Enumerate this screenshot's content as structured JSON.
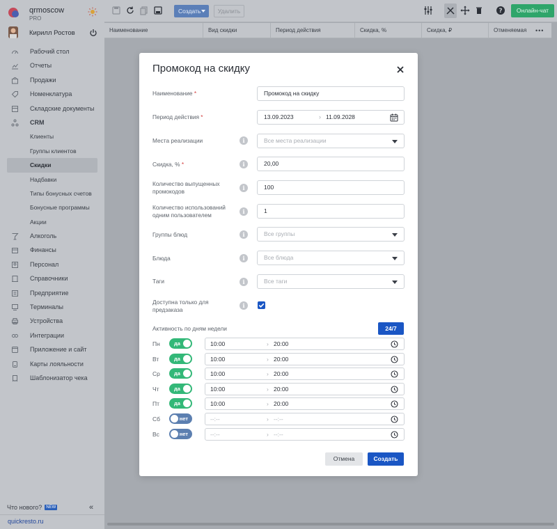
{
  "brand": {
    "name": "qrmoscow",
    "plan": "PRO"
  },
  "user": {
    "name": "Кирилл Ростов"
  },
  "sidebar": {
    "items": [
      {
        "label": "Рабочий стол",
        "icon": "dashboard-icon"
      },
      {
        "label": "Отчеты",
        "icon": "reports-icon"
      },
      {
        "label": "Продажи",
        "icon": "sales-icon"
      },
      {
        "label": "Номенклатура",
        "icon": "tag-icon"
      },
      {
        "label": "Складские документы",
        "icon": "warehouse-icon"
      },
      {
        "label": "CRM",
        "icon": "crm-icon",
        "bold": true
      },
      {
        "label": "Клиенты",
        "sub": true
      },
      {
        "label": "Группы клиентов",
        "sub": true
      },
      {
        "label": "Скидки",
        "sub": true,
        "active": true
      },
      {
        "label": "Надбавки",
        "sub": true
      },
      {
        "label": "Типы бонусных счетов",
        "sub": true
      },
      {
        "label": "Бонусные программы",
        "sub": true
      },
      {
        "label": "Акции",
        "sub": true
      },
      {
        "label": "Алкоголь",
        "icon": "glass-icon"
      },
      {
        "label": "Финансы",
        "icon": "finance-icon"
      },
      {
        "label": "Персонал",
        "icon": "staff-icon"
      },
      {
        "label": "Справочники",
        "icon": "book-icon"
      },
      {
        "label": "Предприятие",
        "icon": "building-icon"
      },
      {
        "label": "Терминалы",
        "icon": "terminal-icon"
      },
      {
        "label": "Устройства",
        "icon": "printer-icon"
      },
      {
        "label": "Интеграции",
        "icon": "link-icon"
      },
      {
        "label": "Приложение и сайт",
        "icon": "app-icon"
      },
      {
        "label": "Карты лояльности",
        "icon": "card-icon"
      },
      {
        "label": "Шаблонизатор чека",
        "icon": "receipt-icon"
      }
    ],
    "whats_new": "Что нового?",
    "new_badge": "NEW",
    "collapse": "«",
    "site": "quickresto.ru"
  },
  "toolbar": {
    "create_label": "Создать",
    "delete_label": "Удалить",
    "chat_label": "Онлайн-чат"
  },
  "table": {
    "columns": [
      "Наименование",
      "Вид скидки",
      "Период действия",
      "Скидка, %",
      "Скидка, ₽",
      "Отменяемая"
    ],
    "more": "•••"
  },
  "modal": {
    "title": "Промокод на скидку",
    "close": "✕",
    "fields": {
      "name_label": "Наименование",
      "name_value": "Промокод на скидку",
      "period_label": "Период действия",
      "period_from": "13.09.2023",
      "period_sep": "›",
      "period_to": "11.09.2028",
      "places_label": "Места реализации",
      "places_placeholder": "Все места реализации",
      "discount_label": "Скидка, %",
      "discount_value": "20,00",
      "issued_label": "Количество выпущенных промокодов",
      "issued_value": "100",
      "uses_label": "Количество использований одним пользователем",
      "uses_value": "1",
      "groups_label": "Группы блюд",
      "groups_placeholder": "Все группы",
      "dishes_label": "Блюда",
      "dishes_placeholder": "Все блюда",
      "tags_label": "Таги",
      "tags_placeholder": "Все таги",
      "preorder_label": "Доступна только для предзаказа",
      "preorder_checked": true,
      "required_mark": "*",
      "info_glyph": "i"
    },
    "activity": {
      "label": "Активность по дням недели",
      "btn_247": "24/7",
      "days": [
        {
          "day": "Пн",
          "on": true,
          "toggle": "да",
          "from": "10:00",
          "to": "20:00"
        },
        {
          "day": "Вт",
          "on": true,
          "toggle": "да",
          "from": "10:00",
          "to": "20:00"
        },
        {
          "day": "Ср",
          "on": true,
          "toggle": "да",
          "from": "10:00",
          "to": "20:00"
        },
        {
          "day": "Чт",
          "on": true,
          "toggle": "да",
          "from": "10:00",
          "to": "20:00"
        },
        {
          "day": "Пт",
          "on": true,
          "toggle": "да",
          "from": "10:00",
          "to": "20:00"
        },
        {
          "day": "Сб",
          "on": false,
          "toggle": "нет",
          "from": "--:--",
          "to": "--:--"
        },
        {
          "day": "Вс",
          "on": false,
          "toggle": "нет",
          "from": "--:--",
          "to": "--:--"
        }
      ]
    },
    "cancel_label": "Отмена",
    "create_label": "Создать"
  },
  "colors": {
    "primary": "#1a56c4",
    "toggle_on": "#33b878",
    "toggle_off": "#5c7fb0",
    "chat": "#2fa56a",
    "required": "#d23b3b"
  }
}
